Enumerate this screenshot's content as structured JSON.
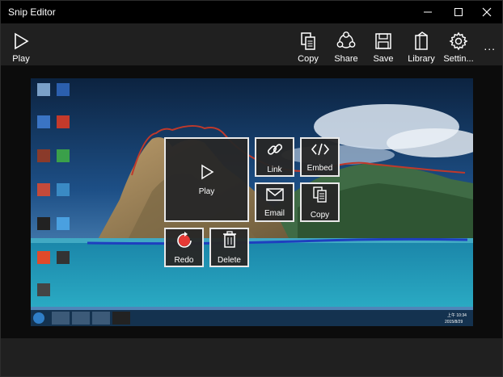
{
  "window": {
    "title": "Snip Editor"
  },
  "toolbar": {
    "play": "Play",
    "copy": "Copy",
    "share": "Share",
    "save": "Save",
    "library": "Library",
    "settings": "Settin...",
    "more": "..."
  },
  "tiles": {
    "play": "Play",
    "link": "Link",
    "embed": "Embed",
    "email": "Email",
    "copy": "Copy",
    "redo": "Redo",
    "delete": "Delete"
  },
  "taskbar": {
    "time": "上午 10:34",
    "date": "2015/8/29"
  },
  "colors": {
    "titlebar": "#000000",
    "commandbar": "#202020",
    "accent_redo": "#e53935",
    "ink_red": "#c0392b",
    "ink_blue": "#1e3fbf"
  },
  "icons": [
    "play-icon",
    "copy-icon",
    "share-icon",
    "save-icon",
    "library-icon",
    "gear-icon",
    "link-icon",
    "embed-icon",
    "email-icon",
    "redo-icon",
    "trash-icon"
  ]
}
